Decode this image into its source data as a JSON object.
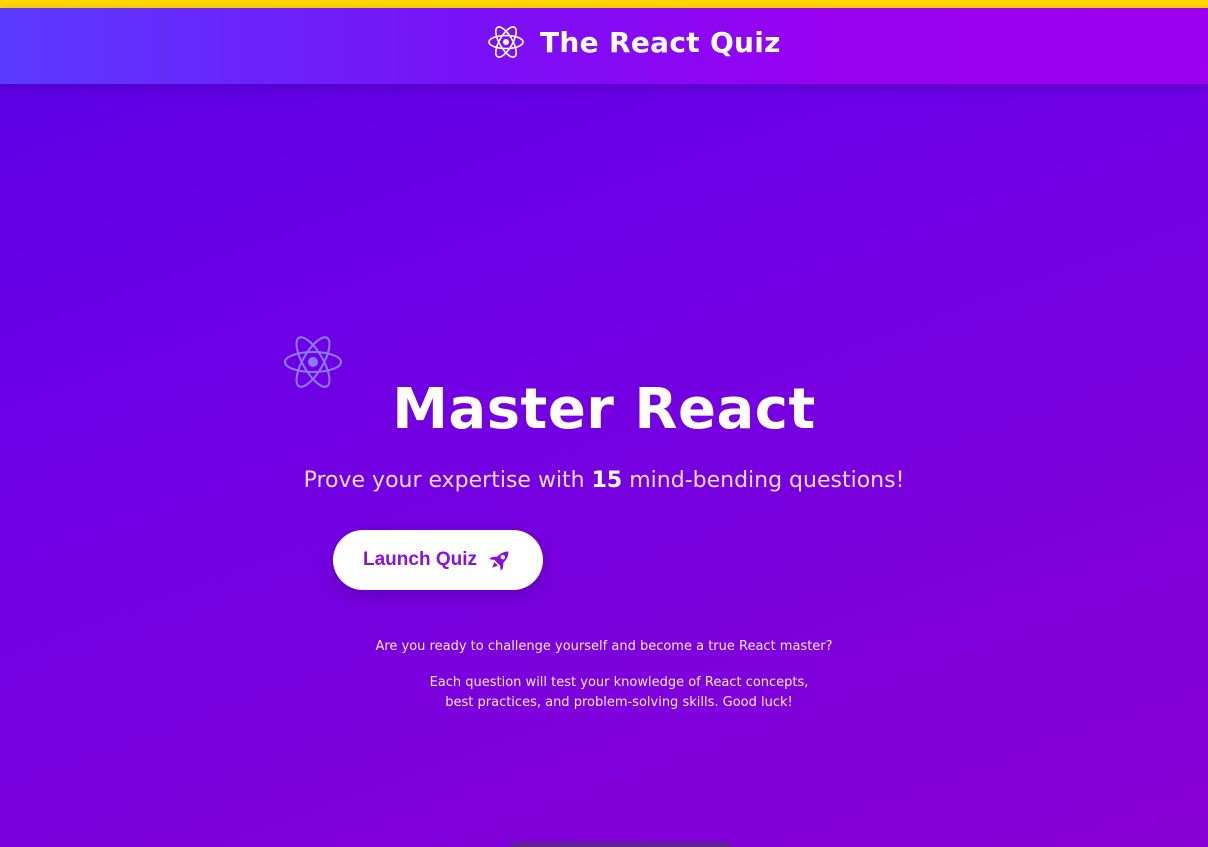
{
  "app": {
    "title": "The React Quiz",
    "logo_icon": "react-atom-icon"
  },
  "hero": {
    "title": "Master React",
    "subtitle_before": "Prove your expertise with ",
    "question_count": "15",
    "subtitle_after": " mind-bending questions!",
    "decor_icon": "react-atom-icon"
  },
  "cta": {
    "label": "Launch Quiz",
    "icon": "rocket-icon"
  },
  "description": {
    "line1": "Are you ready to challenge yourself and become a true React master?",
    "line2": "Each question will test your knowledge of React concepts, best practices, and problem-solving skills. Good luck!"
  },
  "colors": {
    "top_strip": "#ffd700",
    "background_start": "#5b00e6",
    "background_end": "#8700d6",
    "button_text": "#8a12d6",
    "atom_outline_header": "#ffffff",
    "atom_outline_hero": "#8d7bff"
  }
}
